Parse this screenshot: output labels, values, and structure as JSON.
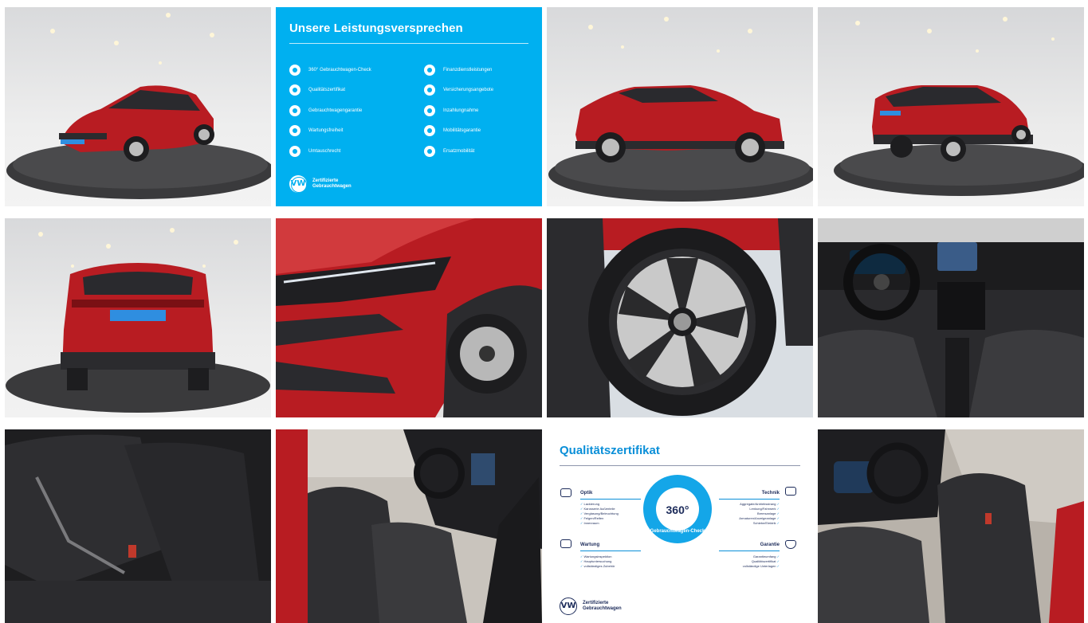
{
  "gallery": {
    "tiles": [
      {
        "name": "front-three-quarter",
        "kind": "car-showroom"
      },
      {
        "name": "services-promise",
        "kind": "info"
      },
      {
        "name": "side-profile",
        "kind": "car-showroom"
      },
      {
        "name": "rear-three-quarter",
        "kind": "car-showroom"
      },
      {
        "name": "rear-view",
        "kind": "car-showroom"
      },
      {
        "name": "headlight-detail",
        "kind": "detail"
      },
      {
        "name": "wheel-detail",
        "kind": "detail"
      },
      {
        "name": "dashboard",
        "kind": "interior"
      },
      {
        "name": "rear-seats",
        "kind": "interior"
      },
      {
        "name": "front-seats-passenger",
        "kind": "interior"
      },
      {
        "name": "quality-certificate",
        "kind": "info"
      },
      {
        "name": "driver-seat",
        "kind": "interior"
      }
    ]
  },
  "promise": {
    "title": "Unsere Leistungsversprechen",
    "left_items": [
      "360° Gebrauchtwagen-Check",
      "Qualitätszertifikat",
      "Gebrauchtwagengarantie",
      "Wartungsfreiheit",
      "Umtauschrecht"
    ],
    "right_items": [
      "Finanzdienstleistungen",
      "Versicherungsangebote",
      "Inzahlungnahme",
      "Mobilitätsgarantie",
      "Ersatzmobilität"
    ],
    "logo": "VW",
    "footer_line1": "Zertifizierte",
    "footer_line2": "Gebrauchtwagen"
  },
  "certificate": {
    "title": "Qualitätszertifikat",
    "badge_number": "360°",
    "badge_text": "Gebrauchtwagen-Check",
    "optik": {
      "heading": "Optik",
      "points": [
        "Lackierung",
        "Karosserie Außenteile",
        "Verglasung/Beleuchtung",
        "Felgen/Reifen",
        "Innenraum"
      ]
    },
    "wartung": {
      "heading": "Wartung",
      "points": [
        "Wartungsinspektion",
        "Hauptuntersuchung",
        "vollständiges Zubehör"
      ]
    },
    "technik": {
      "heading": "Technik",
      "points": [
        "Aggregate/Antriebsstrang",
        "Lenkung/Fahrwerk",
        "Bremsanlage",
        "Armaturen/Anzeigeanlage",
        "Schiebe/Elektrik"
      ]
    },
    "garantie": {
      "heading": "Garantie",
      "points": [
        "Garantieumfang",
        "Qualitätszertifikat",
        "vollständige Unterlagen"
      ]
    },
    "logo": "VW",
    "footer_line1": "Zertifizierte",
    "footer_line2": "Gebrauchtwagen"
  },
  "colors": {
    "car_red": "#b81c22",
    "vw_blue": "#00b0f0",
    "navy": "#1c2b5a"
  }
}
